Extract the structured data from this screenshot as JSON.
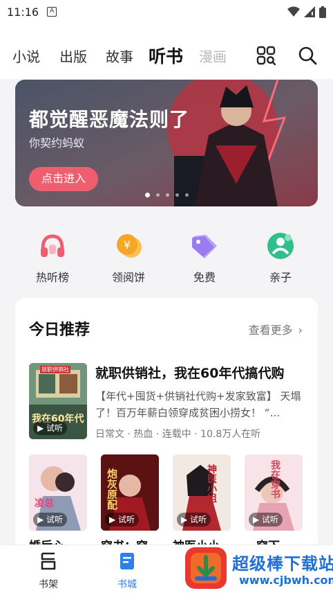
{
  "status": {
    "time": "11:16",
    "notif_glyph": "A"
  },
  "tabs": [
    {
      "label": "小说"
    },
    {
      "label": "出版"
    },
    {
      "label": "故事"
    },
    {
      "label": "听书",
      "active": true
    },
    {
      "label": "漫画"
    }
  ],
  "nav_icons": [
    "grid-apps-icon",
    "search-icon"
  ],
  "banner": {
    "title": "都觉醒恶魔法则了",
    "subtitle": "你契约蚂蚁",
    "button": "点击进入",
    "slide_count": 5,
    "current_slide": 1
  },
  "quick": [
    {
      "label": "热听榜",
      "icon": "headphone-icon",
      "color": "#ef5e6f"
    },
    {
      "label": "领阅饼",
      "icon": "coin-icon",
      "color": "#f6a623"
    },
    {
      "label": "免费",
      "icon": "tag-icon",
      "color": "#9b7cf0"
    },
    {
      "label": "亲子",
      "icon": "family-icon",
      "color": "#2fbf8a"
    }
  ],
  "recommend": {
    "heading": "今日推荐",
    "more": "查看更多",
    "featured": {
      "title": "就职供销社，我在60年代搞代购",
      "desc": "【年代+囤货+供销社代购+发家致富】 天塌了！百万年薪白领穿成贫困小捞女！ “…",
      "meta": "日常文 · 热血 · 连载中 · 10.8万人在听",
      "cover_text": "我在60年代",
      "cover_badge": "就职供销社",
      "cover_try": "试听"
    },
    "grid": [
      {
        "title": "婚后心",
        "try": "试听",
        "cover_text": "凌总"
      },
      {
        "title": "穿书：穿",
        "try": "试听",
        "cover_text": "炮灰原配"
      },
      {
        "title": "神医小小",
        "try": "试听",
        "cover_text": "神医小姐"
      },
      {
        "title": "…穿下",
        "try": "试听",
        "cover_text": "我在穿书"
      }
    ]
  },
  "bottom": [
    {
      "label": "书架",
      "icon": "bookshelf-icon"
    },
    {
      "label": "书城",
      "icon": "bookstore-icon",
      "active": true
    }
  ],
  "watermark": {
    "title": "超级棒下载站",
    "url": "www.cjbwh.com"
  }
}
